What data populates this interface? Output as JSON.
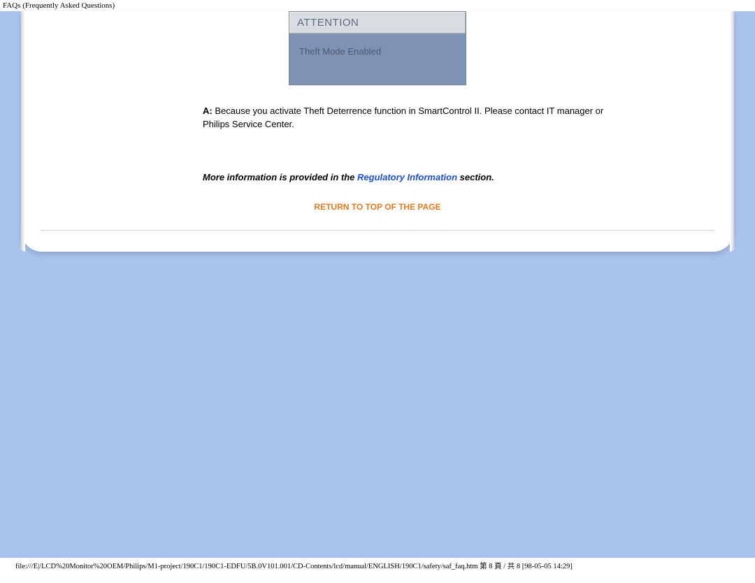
{
  "page": {
    "title": "FAQs (Frequently Asked Questions)"
  },
  "dialog": {
    "title": "ATTENTION",
    "body": "Theft Mode Enabled"
  },
  "answer": {
    "label": "A:",
    "text": " Because you activate Theft Deterrence function in SmartControl II. Please contact IT manager or Philips Service Center."
  },
  "more_info": {
    "prefix": "More information is provided in the ",
    "link": "Regulatory Information",
    "suffix": " section."
  },
  "return_top": "RETURN TO TOP OF THE PAGE",
  "footer": {
    "path": "file:///E|/LCD%20Monitor%20OEM/Philips/M1-project/190C1/190C1-EDFU/5B.0V101.001/CD-Contents/lcd/manual/ENGLISH/190C1/safety/saf_faq.htm 第 8 頁 / 共 8  [98-05-05 14:29]"
  }
}
